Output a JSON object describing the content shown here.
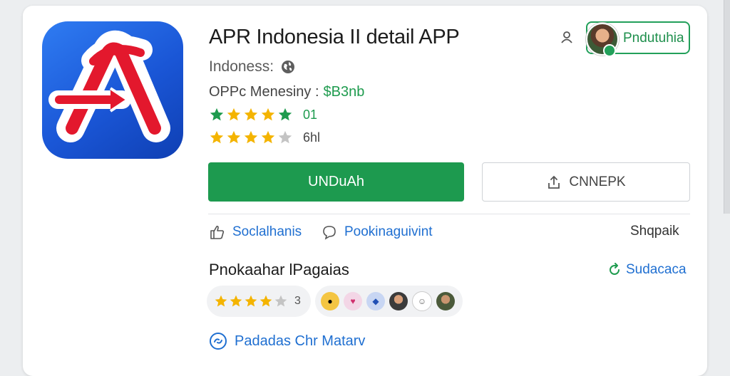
{
  "app": {
    "title": "APR Indonesia II detail APP",
    "subtitle": "Indoness:",
    "price_label": "OPPc Menesiny :",
    "price_value": "$B3nb",
    "rating_row1_value": "01",
    "rating_row2_value": "6hl"
  },
  "header": {
    "download_pill_label": "Pndutuhia"
  },
  "buttons": {
    "primary_label": "UNDuAh",
    "secondary_label": "CNNEPK"
  },
  "actions": {
    "a1_label": "Soclalhanis",
    "a2_label": "Pookinaguivint",
    "a3_label": "Shqpaik"
  },
  "section": {
    "title": "Pnokaahar lPagaias",
    "link_label": "Sudacaca",
    "chip_count": "3"
  },
  "bottom": {
    "link_label": "Padadas Chr Matarv"
  },
  "colors": {
    "accent_green": "#1d9a4f",
    "link_blue": "#1f6fd1",
    "star_gold": "#f4b400",
    "app_icon_blue": "#1a56d6",
    "app_icon_red": "#e3182d"
  },
  "icons": {
    "app_logo": "red-A-arrow-logo",
    "globe": "globe-icon",
    "user": "user-icon",
    "share": "share-icon",
    "thumbs_up": "thumbs-up-icon",
    "comment": "comment-icon",
    "refresh": "refresh-icon",
    "link": "link-icon"
  }
}
